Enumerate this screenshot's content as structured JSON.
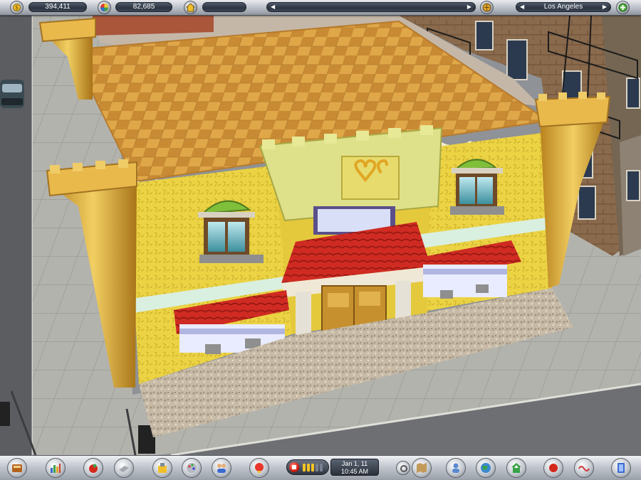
{
  "topbar": {
    "money": "394,411",
    "visitors": "82,685",
    "rating": "",
    "message": "",
    "city": "Los Angeles"
  },
  "clock": {
    "date": "Jan 1, 11",
    "time": "10:45 AM"
  },
  "icons": {
    "money": "coin-icon",
    "visitors": "color-wheel-icon",
    "rating": "house-icon",
    "message_left": "arrow-left-icon",
    "message_right": "arrow-right-icon",
    "city_tool": "globe-icon",
    "zoom": "plus-icon"
  },
  "colors": {
    "wall": "#e9cf3c",
    "roof_tile": "#d69a3c",
    "awning": "#c8261e",
    "street": "#8f9296",
    "sidewalk": "#b4b4ae"
  }
}
